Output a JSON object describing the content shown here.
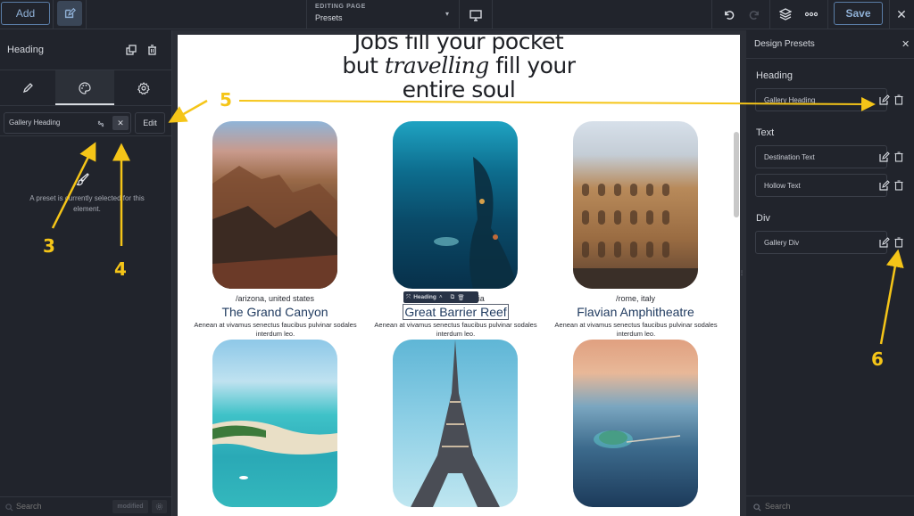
{
  "topbar": {
    "add_label": "Add",
    "editing_label": "EDITING PAGE",
    "editing_value": "Presets",
    "save_label": "Save"
  },
  "left_panel": {
    "title": "Heading",
    "tabs": [
      {
        "name": "pencil-icon",
        "active": false
      },
      {
        "name": "palette-icon",
        "active": true
      },
      {
        "name": "gear-icon",
        "active": false
      }
    ],
    "preset_value": "Gallery Heading",
    "clear_label": "✕",
    "edit_label": "Edit",
    "preset_note": "A preset is currently selected for this element.",
    "search_placeholder": "Search",
    "modified_label": "modified"
  },
  "canvas": {
    "hero_line1": "Jobs fill your pocket",
    "hero_line2_pre": "but ",
    "hero_line2_em": "travelling",
    "hero_line2_post": " fill your",
    "hero_line3": "entire soul",
    "selected_toolbar_label": "Heading",
    "cards": [
      {
        "location": "/arizona, united states",
        "title": "The Grand Canyon",
        "desc": "Aenean at vivamus senectus faucibus pulvinar sodales interdum leo."
      },
      {
        "location": "/cairns, australia",
        "title": "Great Barrier Reef",
        "desc": "Aenean at vivamus senectus faucibus pulvinar sodales interdum leo."
      },
      {
        "location": "/rome, italy",
        "title": "Flavian Amphitheatre",
        "desc": "Aenean at vivamus senectus faucibus pulvinar sodales interdum leo."
      }
    ],
    "row2_images": [
      "maldives-beach",
      "eiffel-tower",
      "island-resort"
    ]
  },
  "right_panel": {
    "title": "Design Presets",
    "groups": [
      {
        "label": "Heading",
        "items": [
          "Gallery Heading"
        ]
      },
      {
        "label": "Text",
        "items": [
          "Destination Text",
          "Hollow Text"
        ]
      },
      {
        "label": "Div",
        "items": [
          "Gallery Div"
        ]
      }
    ],
    "search_placeholder": "Search"
  },
  "annotations": [
    "3",
    "4",
    "5",
    "6"
  ],
  "colors": {
    "accent": "#5a7da6",
    "annotation": "#f5c518",
    "panel_bg": "#21242c",
    "title_blue": "#1f3a5f"
  }
}
